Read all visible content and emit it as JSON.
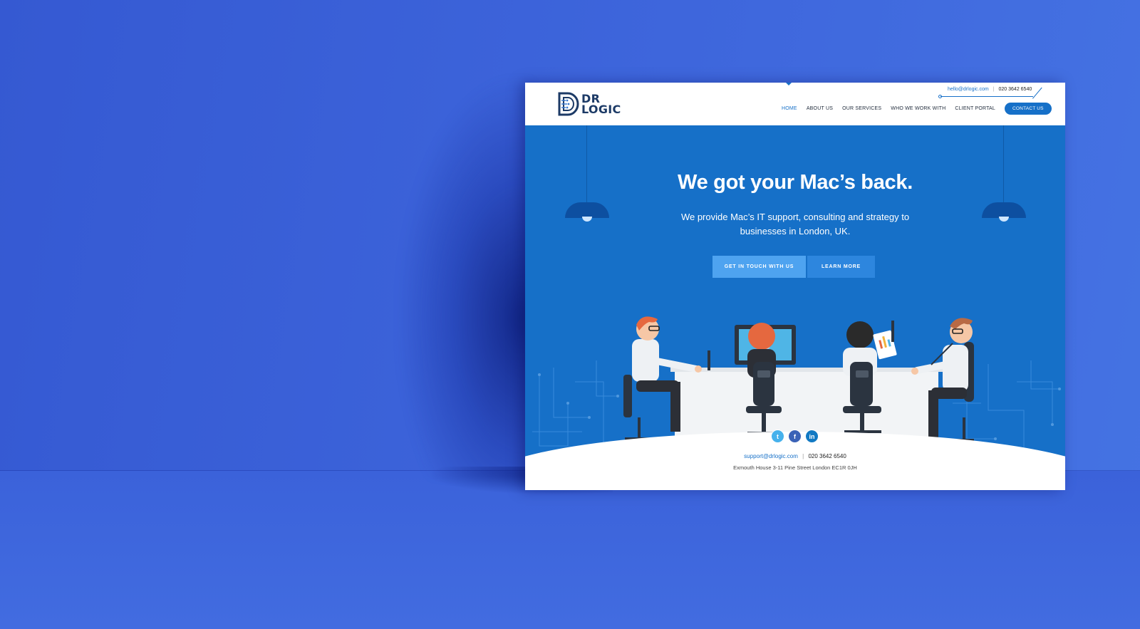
{
  "site": {
    "logo": {
      "line1": "DR",
      "line2": "LOGIC"
    },
    "contact_strip": {
      "email": "hello@drlogic.com",
      "separator": "|",
      "phone": "020 3642 6540"
    },
    "nav": {
      "items": [
        {
          "label": "HOME",
          "active": true
        },
        {
          "label": "ABOUT US",
          "active": false
        },
        {
          "label": "OUR SERVICES",
          "active": false
        },
        {
          "label": "WHO WE WORK WITH",
          "active": false
        },
        {
          "label": "CLIENT PORTAL",
          "active": false
        }
      ],
      "cta": "CONTACT US"
    },
    "hero": {
      "title": "We got your Mac’s back.",
      "subtitle": "We provide Mac’s IT support, consulting and strategy to businesses in London, UK.",
      "primary_button": "GET IN TOUCH WITH US",
      "secondary_button": "LEARN MORE"
    },
    "socials": {
      "twitter": "t",
      "facebook": "f",
      "linkedin": "in"
    },
    "footer": {
      "email": "support@drlogic.com",
      "separator": "|",
      "phone": "020 3642 6540",
      "address": "Exmouth House 3-11 Pine Street London EC1R 0JH"
    },
    "colors": {
      "brand": "#1670c8",
      "backdrop": "#3a5fd6",
      "button_primary": "#4ea3f0",
      "button_secondary": "#2d86de",
      "logo_navy": "#1c3a66"
    }
  }
}
